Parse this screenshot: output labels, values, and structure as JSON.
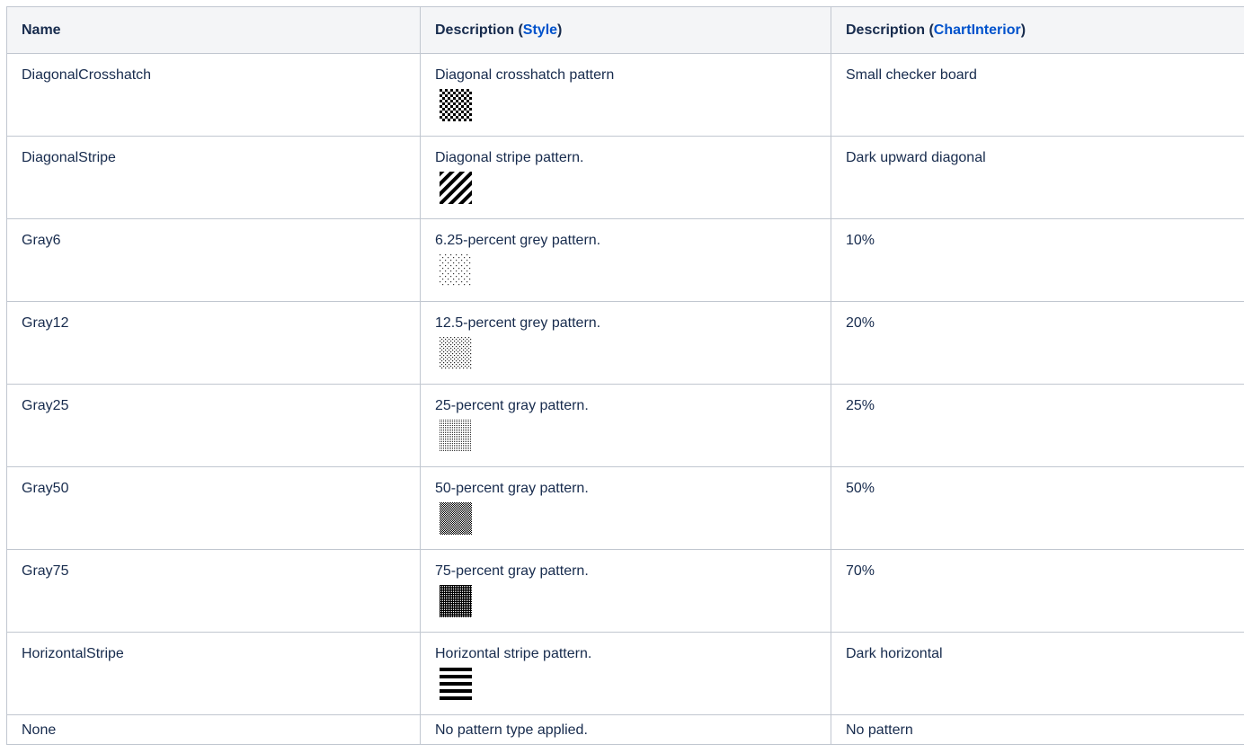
{
  "header": {
    "col1": "Name",
    "col2_prefix": "Description (",
    "col2_link": "Style",
    "col2_suffix": ")",
    "col3_prefix": "Description (",
    "col3_link": "ChartInterior",
    "col3_suffix": ")"
  },
  "rows": [
    {
      "name": "DiagonalCrosshatch",
      "style_desc": "Diagonal crosshatch pattern",
      "chart_desc": "Small checker board",
      "swatch": "checker-swatch-icon"
    },
    {
      "name": "DiagonalStripe",
      "style_desc": "Diagonal stripe pattern.",
      "chart_desc": "Dark upward diagonal",
      "swatch": "diagonal-stripe-swatch-icon"
    },
    {
      "name": "Gray6",
      "style_desc": "6.25-percent grey pattern.",
      "chart_desc": "10%",
      "swatch": "gray6-swatch-icon"
    },
    {
      "name": "Gray12",
      "style_desc": "12.5-percent grey pattern.",
      "chart_desc": "20%",
      "swatch": "gray12-swatch-icon"
    },
    {
      "name": "Gray25",
      "style_desc": "25-percent gray pattern.",
      "chart_desc": "25%",
      "swatch": "gray25-swatch-icon"
    },
    {
      "name": "Gray50",
      "style_desc": "50-percent gray pattern.",
      "chart_desc": "50%",
      "swatch": "gray50-swatch-icon"
    },
    {
      "name": "Gray75",
      "style_desc": "75-percent gray pattern.",
      "chart_desc": "70%",
      "swatch": "gray75-swatch-icon"
    },
    {
      "name": "HorizontalStripe",
      "style_desc": "Horizontal stripe pattern.",
      "chart_desc": "Dark horizontal",
      "swatch": "horizontal-stripe-swatch-icon"
    },
    {
      "name": "None",
      "style_desc": "No pattern type applied.",
      "chart_desc": "No pattern",
      "swatch": ""
    }
  ],
  "colors": {
    "link": "#0052cc",
    "header_bg": "#f4f5f7",
    "border": "#c1c7d0"
  }
}
